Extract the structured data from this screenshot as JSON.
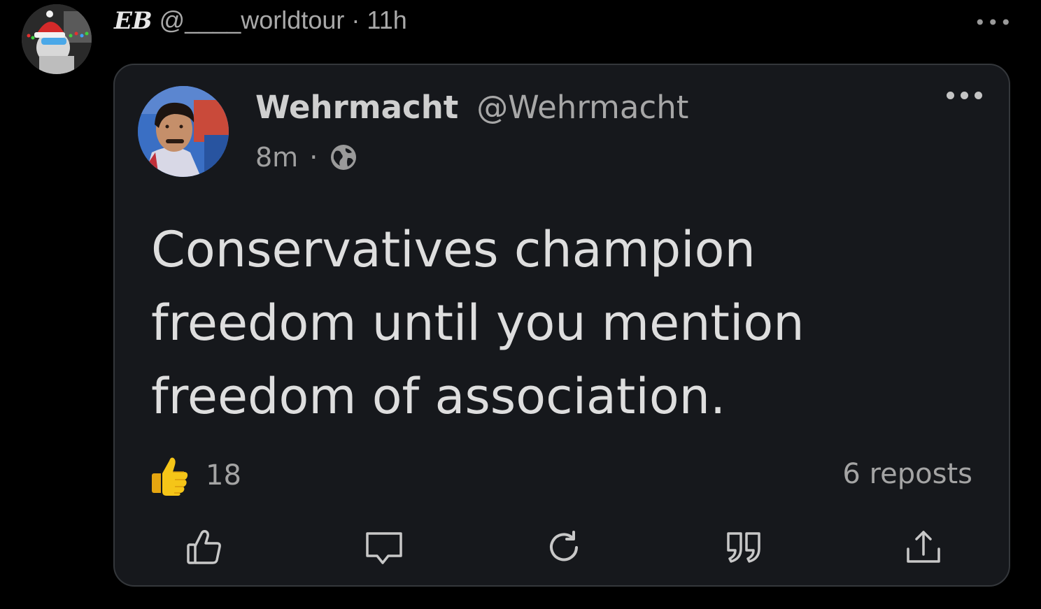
{
  "outer_post": {
    "author_name": "EB",
    "handle": "@____worldtour",
    "separator": "·",
    "time": "11h",
    "more_icon": "more-horizontal-icon",
    "more_label": "•••"
  },
  "quoted_post": {
    "author_name": "Wehrmacht",
    "handle": "@Wehrmacht",
    "time": "8m",
    "separator": "·",
    "visibility_icon": "globe-icon",
    "text": "Conservatives champion freedom until you mention freedom of association.",
    "reaction_icon": "thumbs-up-emoji",
    "reaction_count": "18",
    "reposts_label": "6 reposts"
  },
  "actions": [
    {
      "name": "like",
      "icon": "thumbs-up-icon"
    },
    {
      "name": "comment",
      "icon": "comment-icon"
    },
    {
      "name": "repost",
      "icon": "repost-icon"
    },
    {
      "name": "quote",
      "icon": "quote-icon"
    },
    {
      "name": "share",
      "icon": "share-icon"
    }
  ],
  "colors": {
    "background": "#000000",
    "card_background": "#16181c",
    "card_border": "#34373b",
    "text_primary": "#dedede",
    "text_secondary": "#a4a4a4",
    "emoji_yellow": "#f5c518"
  }
}
